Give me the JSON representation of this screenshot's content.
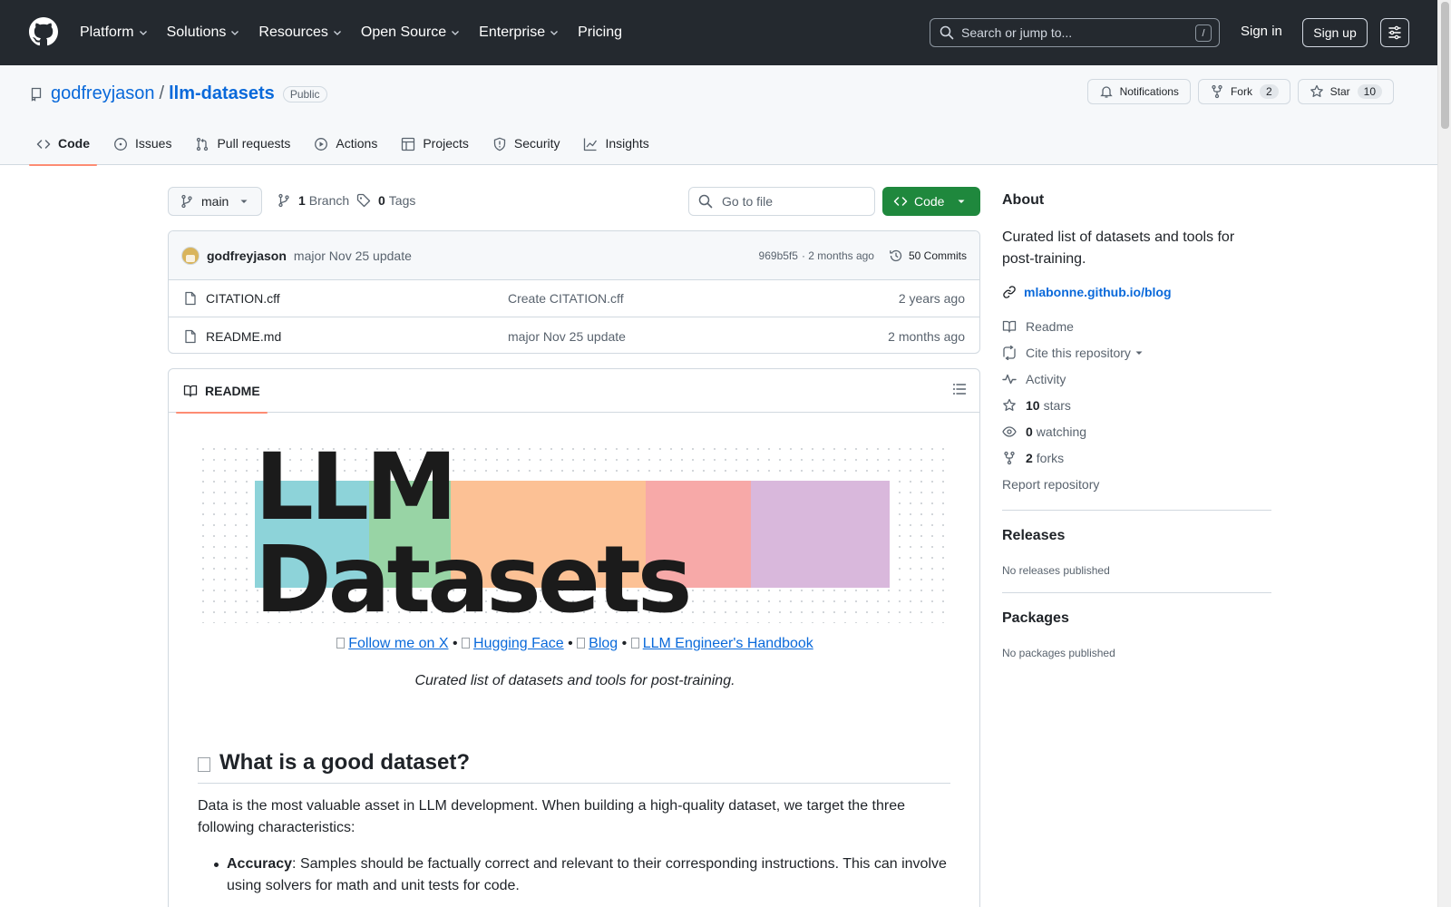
{
  "header": {
    "nav": [
      "Platform",
      "Solutions",
      "Resources",
      "Open Source",
      "Enterprise",
      "Pricing"
    ],
    "search_placeholder": "Search or jump to...",
    "search_shortcut": "/",
    "sign_in": "Sign in",
    "sign_up": "Sign up"
  },
  "repo": {
    "owner": "godfreyjason",
    "name": "llm-datasets",
    "visibility": "Public",
    "notifications_label": "Notifications",
    "fork_label": "Fork",
    "fork_count": "2",
    "star_label": "Star",
    "star_count": "10",
    "tabs": [
      "Code",
      "Issues",
      "Pull requests",
      "Actions",
      "Projects",
      "Security",
      "Insights"
    ]
  },
  "toolbar": {
    "branch": "main",
    "branch_count": "1",
    "branch_label": "Branch",
    "tag_count": "0",
    "tag_label": "Tags",
    "goto_placeholder": "Go to file",
    "code_label": "Code"
  },
  "commit": {
    "author": "godfreyjason",
    "message": "major Nov 25 update",
    "sha": "969b5f5",
    "time": "· 2 months ago",
    "commits_label": "50 Commits"
  },
  "files": [
    {
      "name": "CITATION.cff",
      "message": "Create CITATION.cff",
      "date": "2 years ago"
    },
    {
      "name": "README.md",
      "message": "major Nov 25 update",
      "date": "2 months ago"
    }
  ],
  "readme": {
    "tab_label": "README",
    "banner_text": "LLM Datasets",
    "link_follow": "Follow me on X",
    "link_hf": "Hugging Face",
    "link_blog": "Blog",
    "link_book": "LLM Engineer's Handbook",
    "separator": "•",
    "tagline": "Curated list of datasets and tools for post-training.",
    "h2": "What is a good dataset?",
    "paragraph": "Data is the most valuable asset in LLM development. When building a high-quality dataset, we target the three following characteristics:",
    "bullet_term": "Accuracy",
    "bullet_text": ": Samples should be factually correct and relevant to their corresponding instructions. This can involve using solvers for math and unit tests for code."
  },
  "sidebar": {
    "about_title": "About",
    "about_desc": "Curated list of datasets and tools for post-training.",
    "link": "mlabonne.github.io/blog",
    "readme": "Readme",
    "cite": "Cite this repository",
    "activity": "Activity",
    "stars_count": "10",
    "stars_label": "stars",
    "watching_count": "0",
    "watching_label": "watching",
    "forks_count": "2",
    "forks_label": "forks",
    "report": "Report repository",
    "releases_title": "Releases",
    "releases_sub": "No releases published",
    "packages_title": "Packages",
    "packages_sub": "No packages published"
  },
  "colors": {
    "header_bg": "#24292f",
    "link": "#0969da",
    "primary_button": "#1f883d",
    "tab_underline": "#fd8c73",
    "banner": [
      "#8dd3d9",
      "#98d4a5",
      "#fcc195",
      "#f7a9a8",
      "#d9b8dc"
    ]
  }
}
